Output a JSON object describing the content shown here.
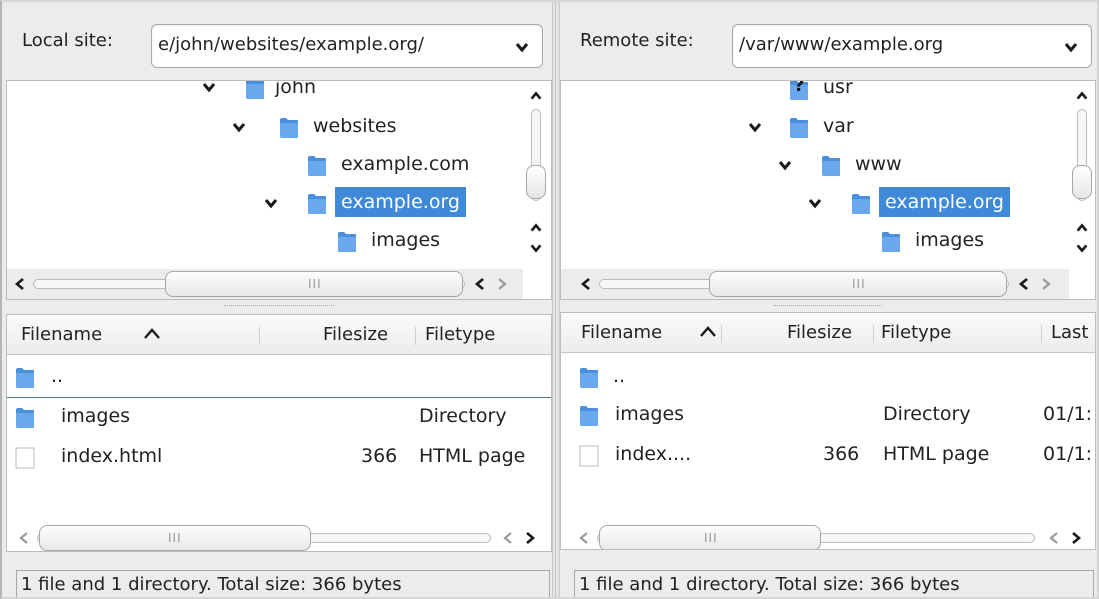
{
  "local": {
    "label": "Local site:",
    "path": "e/john/websites/example.org/",
    "tree": [
      {
        "label": "john",
        "expander": "chevron-down"
      },
      {
        "label": "websites",
        "expander": "chevron-down"
      },
      {
        "label": "example.com",
        "expander": ""
      },
      {
        "label": "example.org",
        "expander": "chevron-down",
        "selected": true
      },
      {
        "label": "images",
        "expander": ""
      }
    ],
    "grip": "III",
    "columns": {
      "filename": "Filename",
      "filesize": "Filesize",
      "filetype": "Filetype"
    },
    "rows": [
      {
        "name": "..",
        "size": "",
        "type": "",
        "icon": "folder-icon"
      },
      {
        "name": "images",
        "size": "",
        "type": "Directory",
        "icon": "folder-icon"
      },
      {
        "name": "index.html",
        "size": "366",
        "type": "HTML page",
        "icon": "file-icon"
      }
    ],
    "status": "1 file and 1 directory. Total size: 366 bytes"
  },
  "remote": {
    "label": "Remote site:",
    "path": "/var/www/example.org",
    "tree": [
      {
        "label": "usr",
        "expander": "",
        "icon": "unknown-folder-icon"
      },
      {
        "label": "var",
        "expander": "chevron-down"
      },
      {
        "label": "www",
        "expander": "chevron-down"
      },
      {
        "label": "example.org",
        "expander": "chevron-down",
        "selected": true
      },
      {
        "label": "images",
        "expander": ""
      }
    ],
    "grip": "III",
    "columns": {
      "filename": "Filename",
      "filesize": "Filesize",
      "filetype": "Filetype",
      "last": "Last"
    },
    "rows": [
      {
        "name": "..",
        "size": "",
        "type": "",
        "date": "",
        "icon": "folder-icon"
      },
      {
        "name": "images",
        "size": "",
        "type": "Directory",
        "date": "01/1:",
        "icon": "folder-icon"
      },
      {
        "name": "index....",
        "size": "366",
        "type": "HTML page",
        "date": "01/1:",
        "icon": "file-icon"
      }
    ],
    "status": "1 file and 1 directory. Total size: 366 bytes"
  },
  "colors": {
    "selection": "#3f89d8",
    "folder": "#4a8fdc"
  }
}
